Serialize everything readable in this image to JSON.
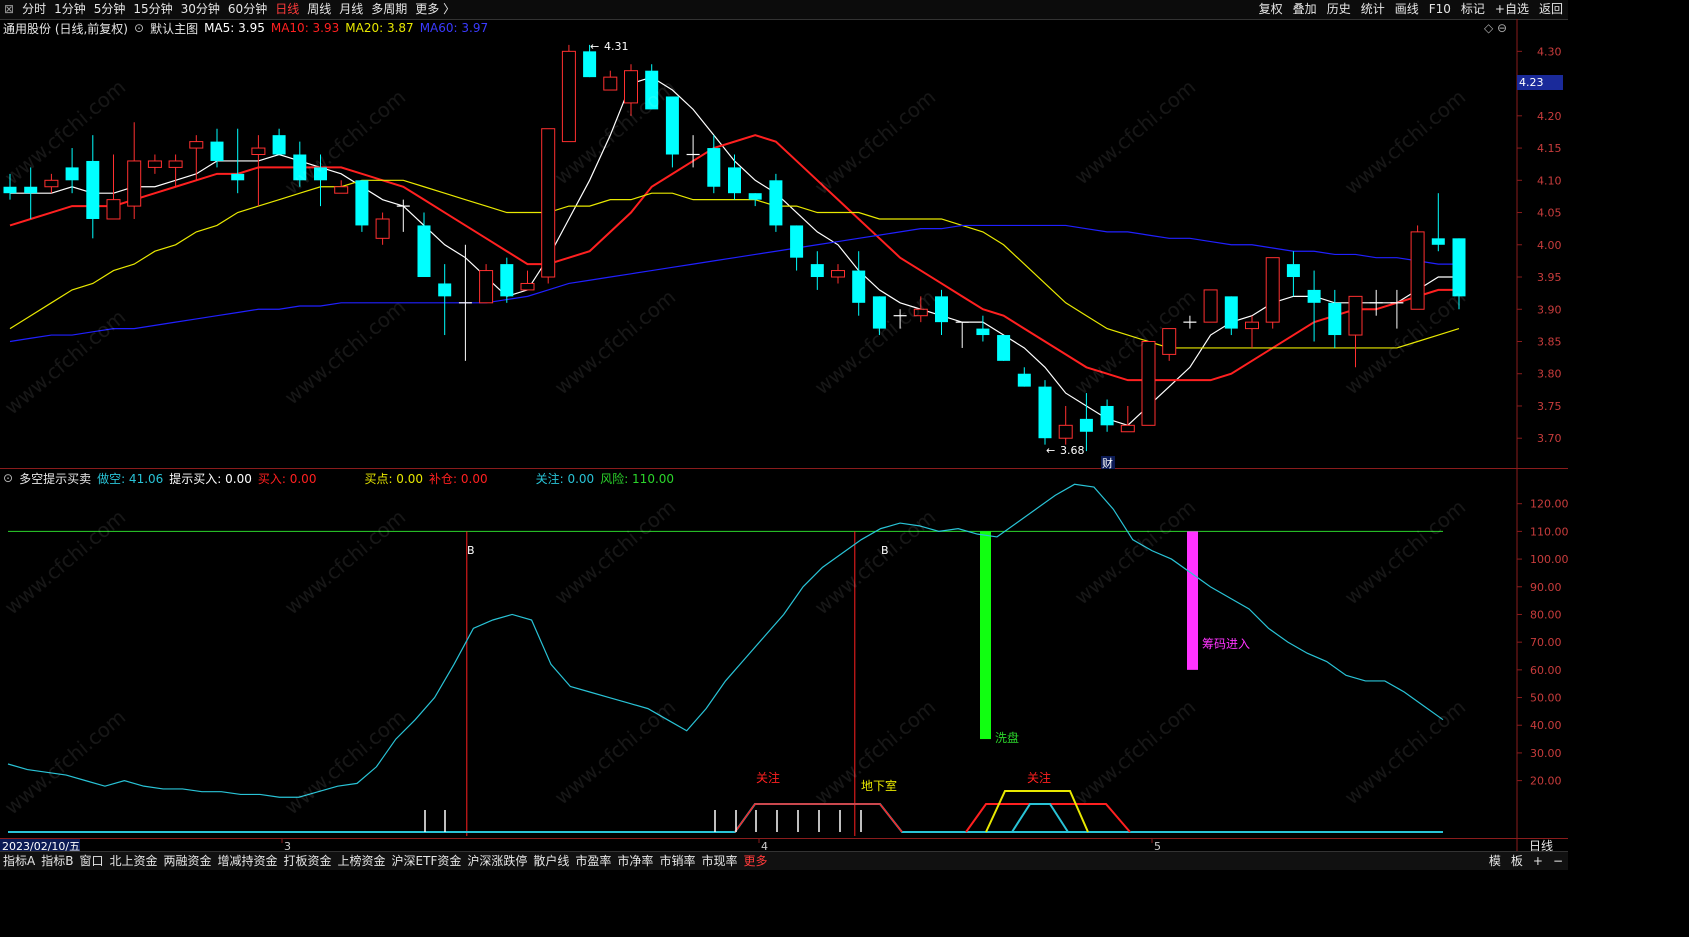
{
  "window": {
    "periods": [
      "分时",
      "1分钟",
      "5分钟",
      "15分钟",
      "30分钟",
      "60分钟",
      "日线",
      "周线",
      "月线",
      "多周期",
      "更多 〉"
    ],
    "active_period": "日线",
    "toolbar_right": [
      "复权",
      "叠加",
      "历史",
      "统计",
      "画线",
      "F10",
      "标记",
      "+自选",
      "返回"
    ]
  },
  "main_legend": {
    "title": "通用股份 (日线,前复权)",
    "template": "默认主图",
    "ma5": "MA5: 3.95",
    "ma10": "MA10: 3.93",
    "ma20": "MA20: 3.87",
    "ma60": "MA60: 3.97",
    "colors": {
      "ma5": "#ffffff",
      "ma10": "#ff2020",
      "ma20": "#e8e800",
      "ma60": "#2020ff"
    }
  },
  "price_axis": {
    "ticks": [
      "4.30",
      "4.25",
      "4.20",
      "4.15",
      "4.10",
      "4.05",
      "4.00",
      "3.95",
      "3.90",
      "3.85",
      "3.80",
      "3.75",
      "3.70"
    ],
    "current": "4.23",
    "high_label": "4.31",
    "low_label": "3.68",
    "event_label": "财"
  },
  "indicator_legend": {
    "name": "多空提示买卖",
    "duokong": "做空: 41.06",
    "tishi": "提示买入: 0.00",
    "mairu": "买入: 0.00",
    "maidian": "买点: 0.00",
    "bucang": "补仓: 0.00",
    "guanzhu": "关注: 0.00",
    "fengxian": "风险: 110.00"
  },
  "indicator_axis": {
    "ticks": [
      "120.00",
      "110.00",
      "100.00",
      "90.00",
      "80.00",
      "70.00",
      "60.00",
      "50.00",
      "40.00",
      "30.00",
      "20.00"
    ]
  },
  "indicator_labels": {
    "b1": "B",
    "b2": "B",
    "xipan": "洗盘",
    "chouma": "筹码进入",
    "guanzhu1": "关注",
    "dixiashi": "地下室",
    "guanzhu2": "关注"
  },
  "date_axis": {
    "start": "2023/02/10/五",
    "m3": "3",
    "m4": "4",
    "m5": "5",
    "period": "日线"
  },
  "bottom_tabs": [
    "指标A",
    "指标B",
    "窗口",
    "北上资金",
    "两融资金",
    "增减持资金",
    "打板资金",
    "上榜资金",
    "沪深ETF资金",
    "沪深涨跌停",
    "散户线",
    "市盈率",
    "市净率",
    "市销率",
    "市现率",
    "更多"
  ],
  "bottom_right": [
    "模",
    "板",
    "+",
    "−"
  ],
  "watermark": "www.cfchi.com",
  "chart_data": [
    {
      "type": "candlestick",
      "title": "通用股份 (日线,前复权)",
      "ylim": [
        3.66,
        4.33
      ],
      "up_color": "#ff3030",
      "down_color": "#00ffff",
      "candles": [
        [
          4.09,
          4.11,
          4.07,
          4.08
        ],
        [
          4.09,
          4.12,
          4.04,
          4.08
        ],
        [
          4.09,
          4.11,
          4.08,
          4.1
        ],
        [
          4.12,
          4.15,
          4.08,
          4.1
        ],
        [
          4.13,
          4.17,
          4.01,
          4.04
        ],
        [
          4.04,
          4.14,
          4.04,
          4.07
        ],
        [
          4.06,
          4.19,
          4.04,
          4.13
        ],
        [
          4.12,
          4.14,
          4.11,
          4.13
        ],
        [
          4.12,
          4.14,
          4.09,
          4.13
        ],
        [
          4.15,
          4.17,
          4.1,
          4.16
        ],
        [
          4.16,
          4.18,
          4.12,
          4.13
        ],
        [
          4.11,
          4.18,
          4.08,
          4.1
        ],
        [
          4.14,
          4.17,
          4.06,
          4.15
        ],
        [
          4.17,
          4.18,
          4.14,
          4.14
        ],
        [
          4.14,
          4.16,
          4.09,
          4.1
        ],
        [
          4.12,
          4.14,
          4.06,
          4.1
        ],
        [
          4.08,
          4.1,
          4.08,
          4.09
        ],
        [
          4.1,
          4.1,
          4.02,
          4.03
        ],
        [
          4.01,
          4.05,
          4.0,
          4.04
        ],
        [
          4.06,
          4.07,
          4.02,
          4.06
        ],
        [
          4.03,
          4.05,
          3.95,
          3.95
        ],
        [
          3.94,
          3.97,
          3.86,
          3.92
        ],
        [
          3.91,
          4.0,
          3.82,
          3.91
        ],
        [
          3.91,
          3.97,
          3.91,
          3.96
        ],
        [
          3.97,
          3.98,
          3.91,
          3.92
        ],
        [
          3.93,
          3.96,
          3.93,
          3.94
        ],
        [
          3.95,
          4.17,
          3.94,
          4.18
        ],
        [
          4.16,
          4.31,
          4.16,
          4.3
        ],
        [
          4.3,
          4.31,
          4.26,
          4.26
        ],
        [
          4.24,
          4.27,
          4.24,
          4.26
        ],
        [
          4.22,
          4.28,
          4.2,
          4.27
        ],
        [
          4.27,
          4.28,
          4.21,
          4.21
        ],
        [
          4.23,
          4.23,
          4.12,
          4.14
        ],
        [
          4.14,
          4.17,
          4.12,
          4.14
        ],
        [
          4.15,
          4.17,
          4.08,
          4.09
        ],
        [
          4.12,
          4.14,
          4.07,
          4.08
        ],
        [
          4.08,
          4.08,
          4.06,
          4.07
        ],
        [
          4.1,
          4.11,
          4.02,
          4.03
        ],
        [
          4.03,
          4.03,
          3.96,
          3.98
        ],
        [
          3.97,
          3.99,
          3.93,
          3.95
        ],
        [
          3.95,
          3.97,
          3.94,
          3.96
        ],
        [
          3.96,
          3.99,
          3.89,
          3.91
        ],
        [
          3.92,
          3.92,
          3.86,
          3.87
        ],
        [
          3.89,
          3.9,
          3.87,
          3.89
        ],
        [
          3.89,
          3.92,
          3.88,
          3.9
        ],
        [
          3.92,
          3.93,
          3.86,
          3.88
        ],
        [
          3.88,
          3.88,
          3.84,
          3.88
        ],
        [
          3.87,
          3.89,
          3.85,
          3.86
        ],
        [
          3.86,
          3.86,
          3.82,
          3.82
        ],
        [
          3.8,
          3.81,
          3.78,
          3.78
        ],
        [
          3.78,
          3.79,
          3.69,
          3.7
        ],
        [
          3.7,
          3.75,
          3.69,
          3.72
        ],
        [
          3.73,
          3.77,
          3.68,
          3.71
        ],
        [
          3.75,
          3.76,
          3.71,
          3.72
        ],
        [
          3.71,
          3.75,
          3.71,
          3.72
        ],
        [
          3.72,
          3.85,
          3.72,
          3.85
        ],
        [
          3.83,
          3.87,
          3.82,
          3.87
        ],
        [
          3.88,
          3.89,
          3.87,
          3.88
        ],
        [
          3.88,
          3.93,
          3.88,
          3.93
        ],
        [
          3.92,
          3.92,
          3.86,
          3.87
        ],
        [
          3.87,
          3.89,
          3.84,
          3.88
        ],
        [
          3.88,
          3.98,
          3.87,
          3.98
        ],
        [
          3.97,
          3.99,
          3.92,
          3.95
        ],
        [
          3.93,
          3.96,
          3.85,
          3.91
        ],
        [
          3.91,
          3.93,
          3.84,
          3.86
        ],
        [
          3.86,
          3.92,
          3.81,
          3.92
        ],
        [
          3.91,
          3.93,
          3.89,
          3.91
        ],
        [
          3.91,
          3.93,
          3.87,
          3.91
        ],
        [
          3.9,
          4.03,
          3.9,
          4.02
        ],
        [
          4.01,
          4.08,
          3.99,
          4.0
        ],
        [
          4.01,
          4.01,
          3.9,
          3.92
        ]
      ],
      "series": [
        {
          "name": "MA5",
          "color": "#ffffff",
          "values": [
            4.08,
            4.08,
            4.08,
            4.09,
            4.08,
            4.08,
            4.09,
            4.09,
            4.1,
            4.11,
            4.13,
            4.13,
            4.13,
            4.14,
            4.13,
            4.12,
            4.11,
            4.09,
            4.07,
            4.06,
            4.03,
            4.0,
            3.98,
            3.95,
            3.92,
            3.93,
            3.98,
            4.04,
            4.1,
            4.17,
            4.25,
            4.26,
            4.24,
            4.21,
            4.17,
            4.13,
            4.1,
            4.08,
            4.05,
            4.02,
            4.0,
            3.96,
            3.93,
            3.91,
            3.9,
            3.89,
            3.88,
            3.88,
            3.86,
            3.84,
            3.81,
            3.77,
            3.75,
            3.73,
            3.72,
            3.75,
            3.78,
            3.81,
            3.86,
            3.88,
            3.89,
            3.91,
            3.92,
            3.92,
            3.91,
            3.91,
            3.91,
            3.91,
            3.93,
            3.95,
            3.95
          ]
        },
        {
          "name": "MA10",
          "color": "#ff2020",
          "values": [
            4.03,
            4.04,
            4.05,
            4.06,
            4.06,
            4.06,
            4.07,
            4.08,
            4.09,
            4.1,
            4.11,
            4.11,
            4.12,
            4.12,
            4.12,
            4.12,
            4.12,
            4.11,
            4.1,
            4.09,
            4.07,
            4.05,
            4.03,
            4.01,
            3.99,
            3.97,
            3.97,
            3.98,
            3.99,
            4.02,
            4.05,
            4.09,
            4.11,
            4.13,
            4.15,
            4.16,
            4.17,
            4.16,
            4.13,
            4.1,
            4.07,
            4.04,
            4.01,
            3.98,
            3.96,
            3.94,
            3.92,
            3.9,
            3.89,
            3.87,
            3.85,
            3.83,
            3.81,
            3.8,
            3.79,
            3.79,
            3.79,
            3.79,
            3.79,
            3.8,
            3.82,
            3.84,
            3.86,
            3.88,
            3.89,
            3.9,
            3.9,
            3.91,
            3.92,
            3.93,
            3.93
          ]
        },
        {
          "name": "MA20",
          "color": "#e8e800",
          "values": [
            3.87,
            3.89,
            3.91,
            3.93,
            3.94,
            3.96,
            3.97,
            3.99,
            4.0,
            4.02,
            4.03,
            4.05,
            4.06,
            4.07,
            4.08,
            4.09,
            4.09,
            4.1,
            4.1,
            4.1,
            4.09,
            4.08,
            4.07,
            4.06,
            4.05,
            4.05,
            4.05,
            4.06,
            4.06,
            4.07,
            4.07,
            4.08,
            4.08,
            4.07,
            4.07,
            4.07,
            4.07,
            4.06,
            4.06,
            4.05,
            4.05,
            4.05,
            4.04,
            4.04,
            4.04,
            4.04,
            4.03,
            4.02,
            4.0,
            3.97,
            3.94,
            3.91,
            3.89,
            3.87,
            3.86,
            3.85,
            3.84,
            3.84,
            3.84,
            3.84,
            3.84,
            3.84,
            3.84,
            3.84,
            3.84,
            3.84,
            3.84,
            3.84,
            3.85,
            3.86,
            3.87
          ]
        },
        {
          "name": "MA60",
          "color": "#2020ff",
          "values": [
            3.85,
            3.855,
            3.86,
            3.86,
            3.865,
            3.87,
            3.87,
            3.875,
            3.88,
            3.885,
            3.89,
            3.895,
            3.9,
            3.9,
            3.905,
            3.905,
            3.91,
            3.91,
            3.91,
            3.91,
            3.91,
            3.91,
            3.91,
            3.91,
            3.915,
            3.92,
            3.93,
            3.94,
            3.945,
            3.95,
            3.955,
            3.96,
            3.965,
            3.97,
            3.975,
            3.98,
            3.985,
            3.99,
            3.995,
            4.0,
            4.005,
            4.01,
            4.015,
            4.02,
            4.025,
            4.025,
            4.03,
            4.03,
            4.03,
            4.03,
            4.03,
            4.03,
            4.025,
            4.02,
            4.02,
            4.015,
            4.01,
            4.01,
            4.005,
            4.0,
            4.0,
            3.995,
            3.99,
            3.99,
            3.985,
            3.985,
            3.98,
            3.98,
            3.975,
            3.97,
            3.97
          ]
        }
      ]
    },
    {
      "type": "line",
      "title": "多空提示买卖",
      "ylim": [
        0,
        130
      ],
      "series": [
        {
          "name": "做空",
          "color": "#29c3d6",
          "values": [
            26,
            24,
            23,
            22,
            20,
            18,
            20,
            18,
            17,
            17,
            16,
            16,
            15,
            15,
            14,
            14,
            16,
            18,
            19,
            25,
            35,
            42,
            50,
            62,
            75,
            78,
            80,
            78,
            62,
            54,
            52,
            50,
            48,
            46,
            42,
            38,
            46,
            56,
            64,
            72,
            80,
            90,
            97,
            102,
            107,
            111,
            113,
            112,
            110,
            111,
            109,
            108,
            113,
            118,
            123,
            127,
            126,
            118,
            107,
            103,
            100,
            95,
            90,
            86,
            82,
            75,
            70,
            66,
            63,
            58,
            56,
            56,
            52,
            47,
            42
          ]
        },
        {
          "name": "风险",
          "color": "#2bd42b",
          "values": [
            110
          ]
        }
      ],
      "signals": {
        "B": [
          22,
          42
        ],
        "洗盘": {
          "index": 47,
          "from": 35,
          "to": 110
        },
        "筹码进入": {
          "index": 57,
          "from": 60,
          "to": 110
        }
      }
    }
  ]
}
